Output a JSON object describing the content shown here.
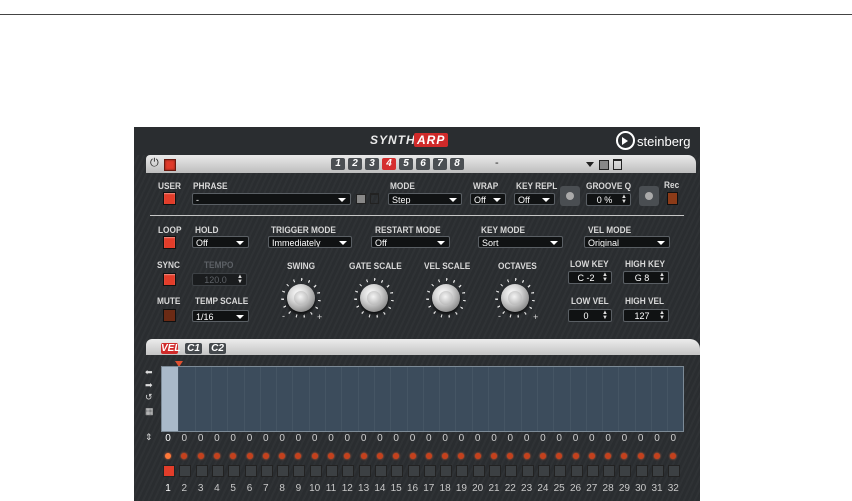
{
  "header": {
    "synth": "SYNTH",
    "arp": "ARP",
    "brand": "steinberg"
  },
  "tabbar": {
    "variations": [
      "1",
      "2",
      "3",
      "4",
      "5",
      "6",
      "7",
      "8"
    ],
    "active_variation": "4",
    "preset": "-"
  },
  "controls": {
    "user": "USER",
    "phrase_label": "PHRASE",
    "phrase_value": "-",
    "mode_label": "MODE",
    "mode_value": "Step",
    "wrap_label": "WRAP",
    "wrap_value": "Off",
    "keyrepl_label": "KEY REPL",
    "keyrepl_value": "Off",
    "grooveq_label": "GROOVE Q",
    "grooveq_value": "0 %",
    "rec_label": "Rec",
    "loop": "LOOP",
    "hold_label": "HOLD",
    "hold_value": "Off",
    "trigger_label": "TRIGGER MODE",
    "trigger_value": "Immediately",
    "restart_label": "RESTART MODE",
    "restart_value": "Off",
    "keymode_label": "KEY MODE",
    "keymode_value": "Sort",
    "velmode_label": "VEL MODE",
    "velmode_value": "Original",
    "sync": "SYNC",
    "tempo_label": "TEMPO",
    "tempo_value": "120.0",
    "mute": "MUTE",
    "tempscale_label": "TEMP SCALE",
    "tempscale_value": "1/16",
    "swing": "SWING",
    "gatescale": "GATE SCALE",
    "velscale": "VEL SCALE",
    "octaves": "OCTAVES",
    "minus": "-",
    "plus": "+",
    "lowkey_label": "LOW KEY",
    "lowkey_value": "C -2",
    "highkey_label": "HIGH KEY",
    "highkey_value": "G 8",
    "lowvel_label": "LOW VEL",
    "lowvel_value": "0",
    "highvel_label": "HIGH VEL",
    "highvel_value": "127"
  },
  "editor": {
    "tabs": [
      "VEL",
      "C1",
      "C2"
    ],
    "values": [
      "0",
      "0",
      "0",
      "0",
      "0",
      "0",
      "0",
      "0",
      "0",
      "0",
      "0",
      "0",
      "0",
      "0",
      "0",
      "0",
      "0",
      "0",
      "0",
      "0",
      "0",
      "0",
      "0",
      "0",
      "0",
      "0",
      "0",
      "0",
      "0",
      "0",
      "0",
      "0"
    ],
    "steps": [
      "1",
      "2",
      "3",
      "4",
      "5",
      "6",
      "7",
      "8",
      "9",
      "10",
      "11",
      "12",
      "13",
      "14",
      "15",
      "16",
      "17",
      "18",
      "19",
      "20",
      "21",
      "22",
      "23",
      "24",
      "25",
      "26",
      "27",
      "28",
      "29",
      "30",
      "31",
      "32"
    ]
  },
  "colors": {
    "accent": "#d02a2a",
    "panel": "#2b2e31",
    "led": "#c4411d"
  }
}
